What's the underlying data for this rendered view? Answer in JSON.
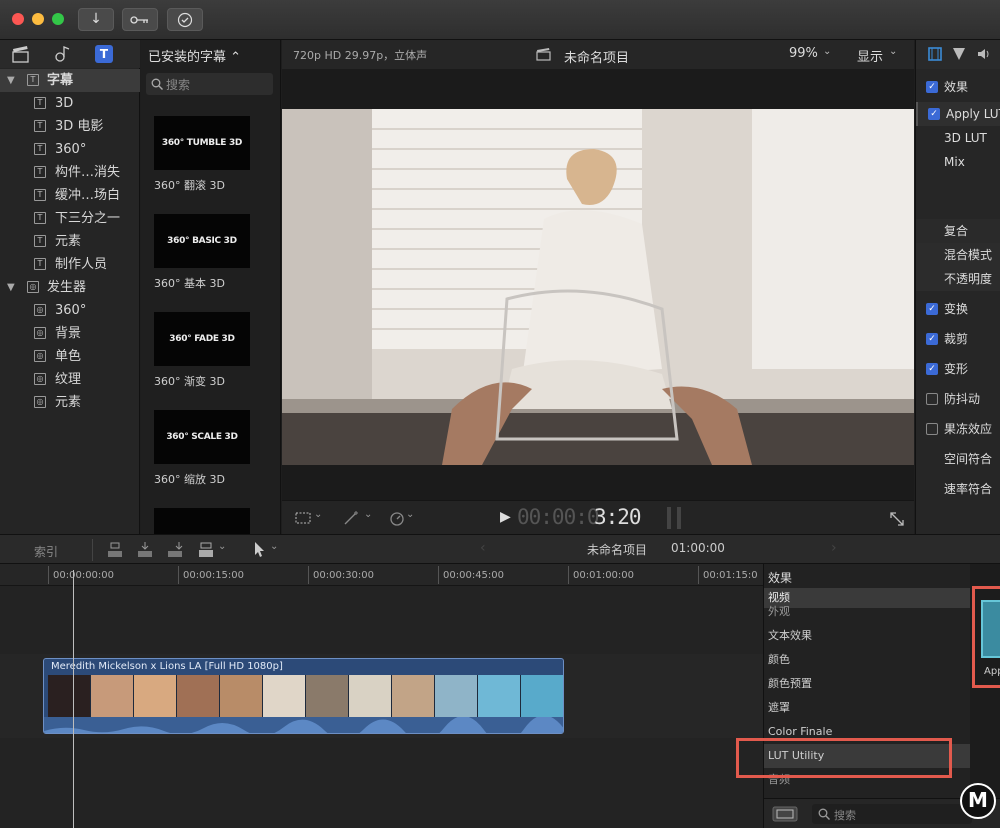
{
  "toolbar": {
    "import_icon": "arrow-down",
    "keywords_icon": "key",
    "background_tasks_icon": "checkmark-circle"
  },
  "library": {
    "items": [
      {
        "label": "字幕",
        "level": 0,
        "expanded": true,
        "selected": true
      },
      {
        "label": "3D",
        "level": 1
      },
      {
        "label": "3D 电影",
        "level": 1
      },
      {
        "label": "360°",
        "level": 1
      },
      {
        "label": "构件…消失",
        "level": 1
      },
      {
        "label": "缓冲…场白",
        "level": 1
      },
      {
        "label": "下三分之一",
        "level": 1
      },
      {
        "label": "元素",
        "level": 1
      },
      {
        "label": "制作人员",
        "level": 1
      },
      {
        "label": "发生器",
        "level": 0,
        "expanded": true
      },
      {
        "label": "360°",
        "level": 1
      },
      {
        "label": "背景",
        "level": 1
      },
      {
        "label": "单色",
        "level": 1
      },
      {
        "label": "纹理",
        "level": 1
      },
      {
        "label": "元素",
        "level": 1
      }
    ]
  },
  "browser": {
    "header": "已安装的字幕 ⌃",
    "search_placeholder": "搜索",
    "thumbs": [
      {
        "art": "360° TUMBLE 3D",
        "caption": "360° 翻滚 3D"
      },
      {
        "art": "360° BASIC 3D",
        "caption": "360° 基本 3D"
      },
      {
        "art": "360° FADE 3D",
        "caption": "360° 渐变 3D"
      },
      {
        "art": "360° SCALE 3D",
        "caption": "360° 缩放 3D"
      }
    ]
  },
  "viewer": {
    "format": "720p HD 29.97p，立体声",
    "project": "未命名项目",
    "zoom": "99%",
    "display_menu": "显示",
    "timecode_dim": "00:00:0",
    "timecode_bright": "3:20"
  },
  "inspector": {
    "rows": [
      {
        "label": "效果",
        "check": true
      },
      {
        "label": "Apply LUT",
        "check": true,
        "boxed": true
      },
      {
        "label": "3D LUT"
      },
      {
        "label": "Mix"
      },
      {
        "label": "复合"
      },
      {
        "label": "混合模式",
        "sub": true
      },
      {
        "label": "不透明度",
        "sub": true
      },
      {
        "label": "变换",
        "check": true
      },
      {
        "label": "裁剪",
        "check": true
      },
      {
        "label": "变形",
        "check": true
      },
      {
        "label": "防抖动",
        "check": false
      },
      {
        "label": "果冻效应",
        "check": false
      },
      {
        "label": "空间符合"
      },
      {
        "label": "速率符合"
      }
    ]
  },
  "timeline_bar": {
    "index_label": "索引",
    "project": "未命名项目",
    "duration": "01:00:00"
  },
  "timeline": {
    "ticks": [
      "00:00:00:00",
      "00:00:15:00",
      "00:00:30:00",
      "00:00:45:00",
      "00:01:00:00",
      "00:01:15:0"
    ],
    "clip_title": "Meredith Mickelson x Lions LA [Full HD 1080p]"
  },
  "effects": {
    "title": "效果",
    "categories": [
      "视频",
      "外观",
      "文本效果",
      "颜色",
      "颜色预置",
      "遮罩",
      "Color Finale",
      "LUT Utility",
      "音频"
    ],
    "selected": "LUT Utility",
    "search_placeholder": "搜索",
    "preview_caption": "App"
  },
  "colors": {
    "accent": "#3b6ad6",
    "highlight_box": "#e25a4d",
    "clip": "#2c4a78"
  }
}
